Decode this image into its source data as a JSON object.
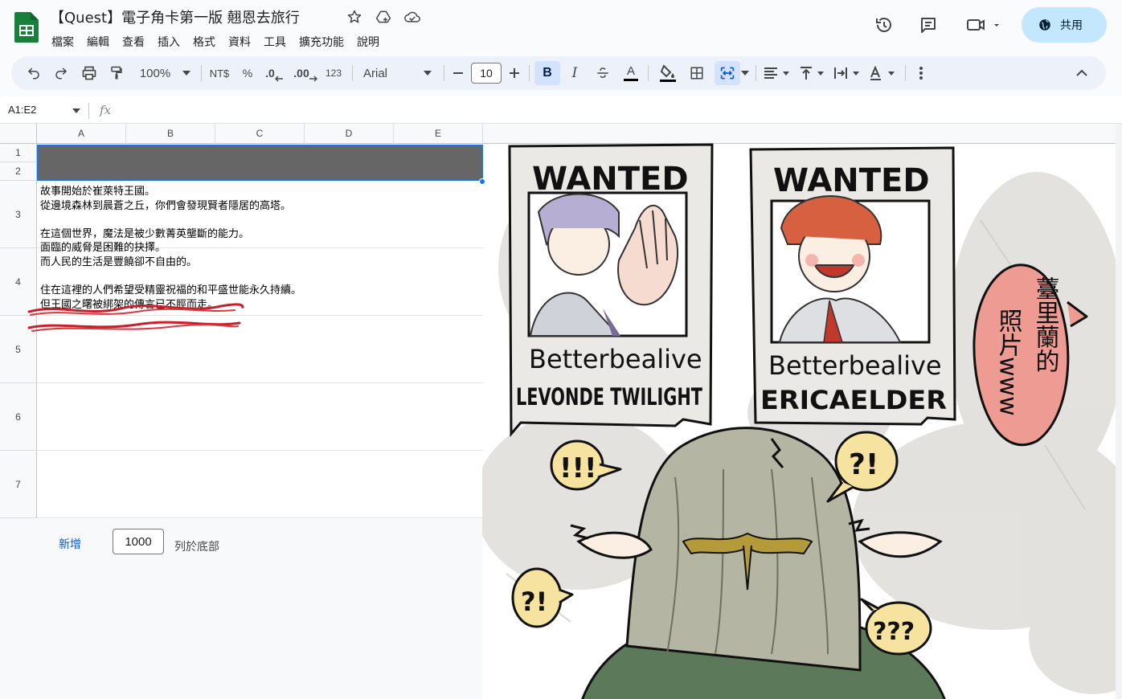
{
  "window": {
    "doc_title": "【Quest】電子角卡第一版 翹恩去旅行",
    "menu": [
      "檔案",
      "編輯",
      "查看",
      "插入",
      "格式",
      "資料",
      "工具",
      "擴充功能",
      "說明"
    ],
    "share_label": "共用"
  },
  "toolbar": {
    "zoom": "100%",
    "currency": "NT$",
    "percent": "%",
    "dec_decrease": ".0",
    "dec_increase": ".00",
    "number_format": "123",
    "font_name": "Arial",
    "font_size": "10",
    "bold": "B",
    "italic": "I",
    "text_color": "A"
  },
  "formula_bar": {
    "name_box": "A1:E2",
    "fx": "fx"
  },
  "grid": {
    "columns": [
      "A",
      "B",
      "C",
      "D",
      "E"
    ],
    "rows": [
      "1",
      "2",
      "3",
      "4",
      "5",
      "6",
      "7"
    ],
    "story": "故事開始於崔萊特王國。\n從邊境森林到晨蒼之丘，你們會發現賢者隱居的高塔。\n\n在這個世界，魔法是被少數菁英壟斷的能力。\n面臨的威脅是困難的抉擇。\n而人民的生活是豐饒卻不自由的。\n\n住在這裡的人們希望受精靈祝福的和平盛世能永久持續。\n但王國之曙被綁架的傳言已不脛而走。"
  },
  "add_rows": {
    "link": "新增",
    "count": "1000",
    "suffix": "列於底部"
  },
  "illustration": {
    "poster_left": {
      "header": "WANTED",
      "line1": "Betterbealive",
      "line2": "LEVONDE TWILIGHT"
    },
    "poster_right": {
      "header": "WANTED",
      "line1": "Betterbealive",
      "line2": "ERICAELDER"
    },
    "speech_right": [
      "薹里蘭的",
      "照片www"
    ],
    "bubbles": [
      "!!!",
      "?!",
      "?!",
      "???"
    ]
  },
  "colors": {
    "share_bg": "#c2e7ff",
    "toolbar_bg": "#edf2fa",
    "selection": "#1a73e8",
    "merged_fill": "#666666",
    "app_green": "#188038"
  }
}
